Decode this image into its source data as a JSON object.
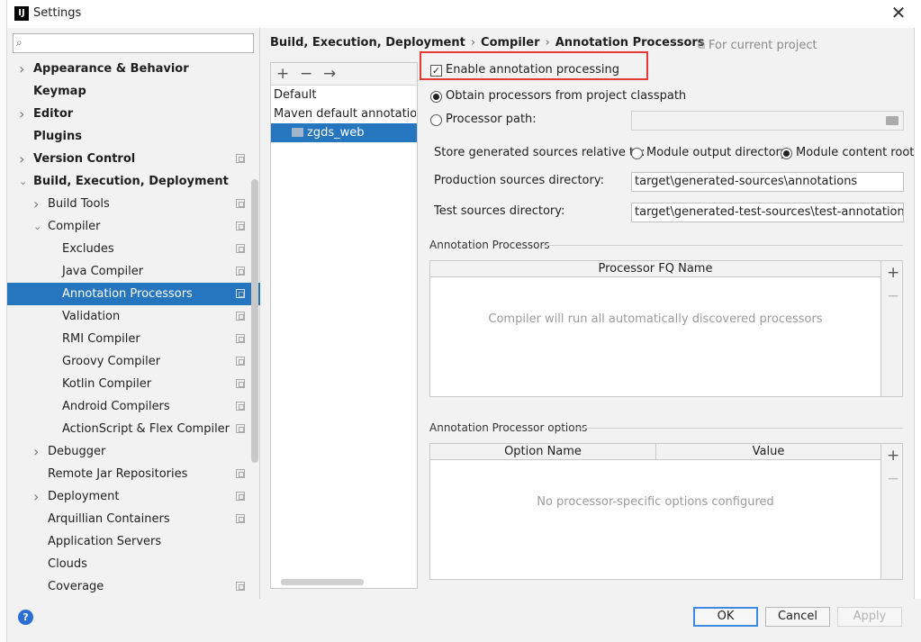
{
  "window": {
    "title": "Settings",
    "app_icon_text": "IJ"
  },
  "search": {
    "placeholder": ""
  },
  "tree": [
    {
      "label": "Appearance & Behavior",
      "bold": true,
      "expandable": "closed",
      "level": 0
    },
    {
      "label": "Keymap",
      "bold": true,
      "expandable": "none",
      "level": 0
    },
    {
      "label": "Editor",
      "bold": true,
      "expandable": "closed",
      "level": 0
    },
    {
      "label": "Plugins",
      "bold": true,
      "expandable": "none",
      "level": 0
    },
    {
      "label": "Version Control",
      "bold": true,
      "expandable": "closed",
      "level": 0,
      "project": true
    },
    {
      "label": "Build, Execution, Deployment",
      "bold": true,
      "expandable": "open",
      "level": 0
    },
    {
      "label": "Build Tools",
      "bold": false,
      "expandable": "closed",
      "level": 1,
      "project": true
    },
    {
      "label": "Compiler",
      "bold": false,
      "expandable": "open",
      "level": 1,
      "project": true
    },
    {
      "label": "Excludes",
      "bold": false,
      "expandable": "none",
      "level": 2,
      "project": true
    },
    {
      "label": "Java Compiler",
      "bold": false,
      "expandable": "none",
      "level": 2,
      "project": true
    },
    {
      "label": "Annotation Processors",
      "bold": false,
      "expandable": "none",
      "level": 2,
      "project": true,
      "selected": true
    },
    {
      "label": "Validation",
      "bold": false,
      "expandable": "none",
      "level": 2,
      "project": true
    },
    {
      "label": "RMI Compiler",
      "bold": false,
      "expandable": "none",
      "level": 2,
      "project": true
    },
    {
      "label": "Groovy Compiler",
      "bold": false,
      "expandable": "none",
      "level": 2,
      "project": true
    },
    {
      "label": "Kotlin Compiler",
      "bold": false,
      "expandable": "none",
      "level": 2,
      "project": true
    },
    {
      "label": "Android Compilers",
      "bold": false,
      "expandable": "none",
      "level": 2,
      "project": true
    },
    {
      "label": "ActionScript & Flex Compiler",
      "bold": false,
      "expandable": "none",
      "level": 2,
      "project": true
    },
    {
      "label": "Debugger",
      "bold": false,
      "expandable": "closed",
      "level": 1
    },
    {
      "label": "Remote Jar Repositories",
      "bold": false,
      "expandable": "none",
      "level": 1,
      "project": true
    },
    {
      "label": "Deployment",
      "bold": false,
      "expandable": "closed",
      "level": 1,
      "project": true
    },
    {
      "label": "Arquillian Containers",
      "bold": false,
      "expandable": "none",
      "level": 1,
      "project": true
    },
    {
      "label": "Application Servers",
      "bold": false,
      "expandable": "none",
      "level": 1
    },
    {
      "label": "Clouds",
      "bold": false,
      "expandable": "none",
      "level": 1
    },
    {
      "label": "Coverage",
      "bold": false,
      "expandable": "none",
      "level": 1,
      "project": true
    }
  ],
  "breadcrumb": {
    "items": [
      "Build, Execution, Deployment",
      "Compiler",
      "Annotation Processors"
    ],
    "separator": "›"
  },
  "scope_hint": "For current project",
  "profiles": {
    "toolbar": {
      "add": "+",
      "remove": "−",
      "move": "→"
    },
    "items": [
      "Default",
      "Maven default annotation p",
      "zgds_web"
    ]
  },
  "settings": {
    "enable_label": "Enable annotation processing",
    "enable_checked": true,
    "obtain_label": "Obtain processors from project classpath",
    "processor_path_label": "Processor path:",
    "processor_path_value": "",
    "store_label": "Store generated sources relative to:",
    "module_output_label": "Module output directory",
    "module_content_label": "Module content root",
    "production_label": "Production sources directory:",
    "production_value": "target\\generated-sources\\annotations",
    "test_label": "Test sources directory:",
    "test_value": "target\\generated-test-sources\\test-annotations"
  },
  "processors": {
    "section_title": "Annotation Processors",
    "column": "Processor FQ Name",
    "empty_text": "Compiler will run all automatically discovered processors",
    "add": "+",
    "remove": "−"
  },
  "options": {
    "section_title": "Annotation Processor options",
    "columns": [
      "Option Name",
      "Value"
    ],
    "empty_text": "No processor-specific options configured",
    "add": "+",
    "remove": "−"
  },
  "footer": {
    "help": "?",
    "ok": "OK",
    "cancel": "Cancel",
    "apply": "Apply"
  },
  "colors": {
    "selection": "#2675bf",
    "highlight_box": "#e53935",
    "primary_button_border": "#3c8ae2"
  }
}
